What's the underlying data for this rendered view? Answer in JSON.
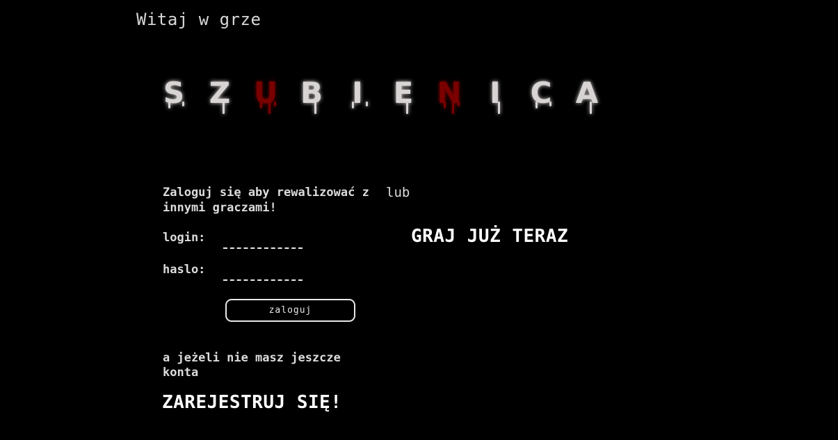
{
  "header": {
    "welcome": "Witaj w grze"
  },
  "logo": {
    "letters": [
      "S",
      "Z",
      "U",
      "B",
      "I",
      "E",
      "N",
      "I",
      "C",
      "A"
    ],
    "red_letter_indices": [
      2,
      6
    ],
    "light_color": "#d9d4d4",
    "red_color": "#7a0000",
    "glow_color": "#ff1a1a"
  },
  "login": {
    "intro": "Zaloguj się aby rewalizować z innymi graczami!",
    "login_label": "login:",
    "password_label": "haslo:",
    "login_value": "",
    "password_value": "",
    "button_label": "zaloguj"
  },
  "alternative": {
    "or_text": "lub",
    "play_now": "GRAJ JUŻ TERAZ"
  },
  "register": {
    "prompt": "a jeżeli nie masz jeszcze konta",
    "link": "ZAREJESTRUJ SIĘ!"
  }
}
